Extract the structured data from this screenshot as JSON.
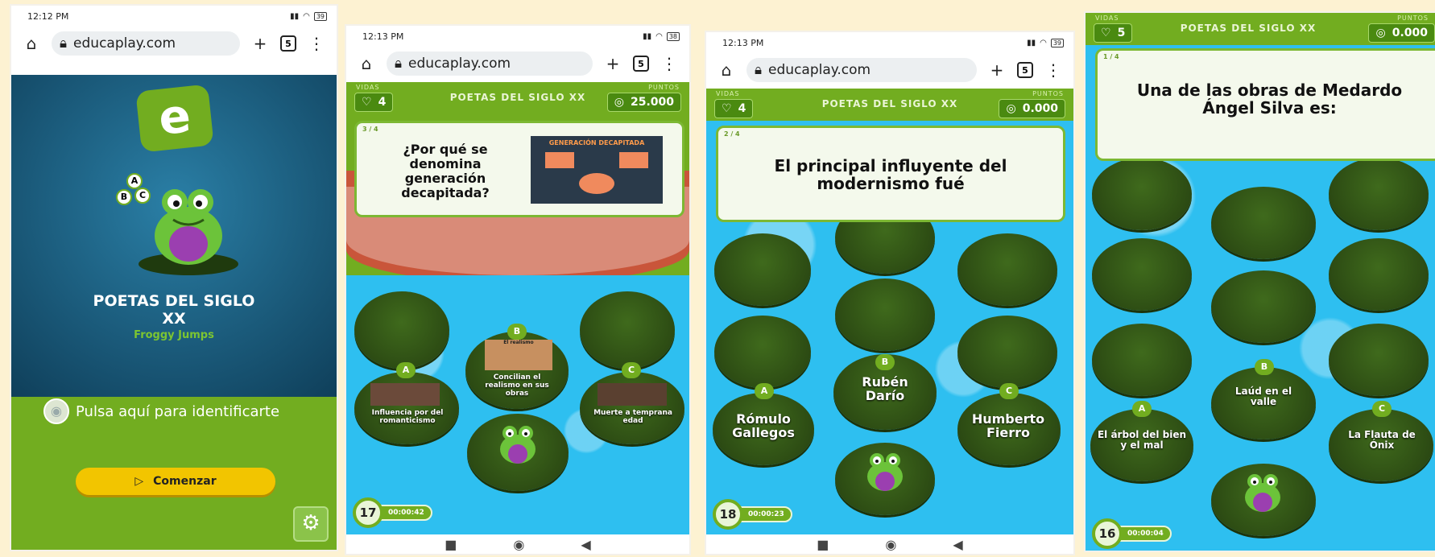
{
  "screen1": {
    "time": "12:12 PM",
    "battery": "39",
    "url": "educaplay.com",
    "tab_count": "5",
    "title_line1": "POETAS DEL SIGLO",
    "title_line2": "XX",
    "subtitle": "Froggy Jumps",
    "identify": "Pulsa aquí para identificarte",
    "start": "Comenzar",
    "logo_letter": "e",
    "bubbles": [
      "A",
      "B",
      "C"
    ]
  },
  "screen2": {
    "time": "12:13 PM",
    "battery": "38",
    "url": "educaplay.com",
    "tab_count": "5",
    "lives_label": "VIDAS",
    "points_label": "PUNTOS",
    "lives": "4",
    "points": "25.000",
    "game_title": "POETAS DEL SIGLO XX",
    "q_number": "3 / 4",
    "question": "¿Por qué se denomina generación decapitada?",
    "diagram_title": "GENERACIÓN DECAPITADA",
    "answers": [
      {
        "letter": "A",
        "text": "Influencia por del romanticismo"
      },
      {
        "letter": "B",
        "text": "Concilian el realismo en sus obras",
        "img_caption": "El realismo"
      },
      {
        "letter": "C",
        "text": "Muerte a temprana edad"
      }
    ],
    "counter": "17",
    "timer": "00:00:42"
  },
  "screen3": {
    "time": "12:13 PM",
    "battery": "39",
    "url": "educaplay.com",
    "tab_count": "5",
    "lives_label": "VIDAS",
    "points_label": "PUNTOS",
    "lives": "4",
    "points": "0.000",
    "game_title": "POETAS DEL SIGLO XX",
    "q_number": "2 / 4",
    "question": "El principal influyente del modernismo fué",
    "answers": [
      {
        "letter": "A",
        "text": "Rómulo Gallegos"
      },
      {
        "letter": "B",
        "text": "Rubén Darío"
      },
      {
        "letter": "C",
        "text": "Humberto Fierro"
      }
    ],
    "counter": "18",
    "timer": "00:00:23"
  },
  "screen4": {
    "lives_label": "VIDAS",
    "points_label": "PUNTOS",
    "lives": "5",
    "points": "0.000",
    "game_title": "POETAS DEL SIGLO XX",
    "q_number": "1 / 4",
    "question": "Una de las obras de Medardo Ángel Silva es:",
    "answers": [
      {
        "letter": "A",
        "text": "El árbol del bien y el mal"
      },
      {
        "letter": "B",
        "text": "Laúd en el valle"
      },
      {
        "letter": "C",
        "text": "La Flauta de Ónix"
      }
    ],
    "counter": "16",
    "timer": "00:00:04"
  },
  "colors": {
    "green": "#72ad20",
    "water": "#2ebff0",
    "yellow": "#f2c500",
    "background": "#fdf2d2"
  },
  "icons": [
    "home-icon",
    "lock-icon",
    "plus-icon",
    "tabs-icon",
    "menu-icon",
    "heart-icon",
    "coin-icon",
    "gear-icon",
    "play-icon",
    "user-icon"
  ]
}
